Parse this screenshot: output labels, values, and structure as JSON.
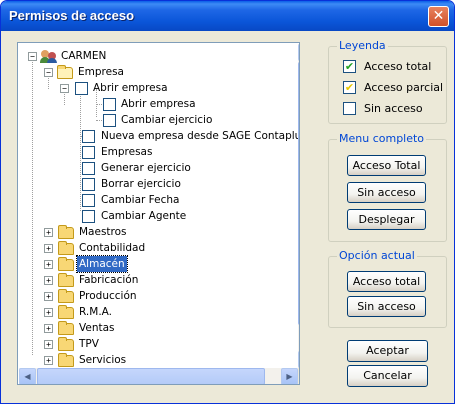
{
  "window": {
    "title": "Permisos de acceso",
    "close_glyph": "✕"
  },
  "tree": {
    "root": "CARMEN",
    "empresa": "Empresa",
    "abrir_empresa_group": "Abrir empresa",
    "abrir_empresa": "Abrir empresa",
    "cambiar_ejercicio": "Cambiar ejercicio",
    "nueva_empresa": "Nueva empresa desde SAGE Contaplus/F",
    "empresas": "Empresas",
    "generar_ejercicio": "Generar ejercicio",
    "borrar_ejercicio": "Borrar ejercicio",
    "cambiar_fecha": "Cambiar Fecha",
    "cambiar_agente": "Cambiar Agente",
    "maestros": "Maestros",
    "contabilidad": "Contabilidad",
    "almacen": "Almacén",
    "fabricacion": "Fabricación",
    "produccion": "Producción",
    "rma": "R.M.A.",
    "ventas": "Ventas",
    "tpv": "TPV",
    "servicios": "Servicios",
    "expand_glyph": "+",
    "collapse_glyph": "−"
  },
  "scrollbar": {
    "up": "▲",
    "down": "▼",
    "left": "◀",
    "right": "▶"
  },
  "legend": {
    "title": "Leyenda",
    "total": "Acceso total",
    "parcial": "Acceso parcial",
    "sin": "Sin acceso",
    "check_glyph": "✔",
    "total_color": "#21a121",
    "parcial_color": "#e8c800"
  },
  "menu_completo": {
    "title": "Menu completo",
    "total": "Acceso Total",
    "sin": "Sin acceso",
    "desplegar": "Desplegar"
  },
  "opcion_actual": {
    "title": "Opción actual",
    "total": "Acceso total",
    "sin": "Sin acceso"
  },
  "footer": {
    "aceptar": "Aceptar",
    "cancelar": "Cancelar"
  }
}
